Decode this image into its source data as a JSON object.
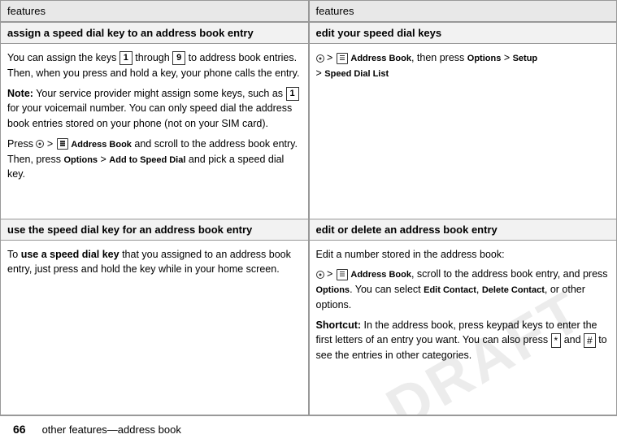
{
  "watermark": "DRAFT",
  "footer": {
    "page_number": "66",
    "text": "other features—address book"
  },
  "left_column": {
    "header": "features",
    "section1": {
      "subheader": "assign a speed dial key to an address book entry",
      "paragraphs": [
        "You can assign the keys 1 through 9 to address book entries. Then, when you press and hold a key, your phone calls the entry.",
        "Note: Your service provider might assign some keys, such as 1 for your voicemail number. You can only speed dial the address book entries stored on your phone (not on your SIM card).",
        "Press • > Address Book and scroll to the address book entry. Then, press Options > Add to Speed Dial and pick a speed dial key."
      ]
    },
    "section2": {
      "subheader": "use the speed dial key for an address book entry",
      "paragraph": "To use a speed dial key that you assigned to an address book entry, just press and hold the key while in your home screen."
    }
  },
  "right_column": {
    "header": "features",
    "section1": {
      "subheader": "edit your speed dial keys",
      "content": "• > Address Book, then press Options > Setup > Speed Dial List"
    },
    "section2": {
      "subheader": "edit or delete an address book entry",
      "paragraphs": [
        "Edit a number stored in the address book:",
        "• > Address Book, scroll to the address book entry, and press Options. You can select Edit Contact, Delete Contact, or other options.",
        "Shortcut: In the address book, press keypad keys to enter the first letters of an entry you want. You can also press * and # to see the entries in other categories."
      ]
    }
  }
}
